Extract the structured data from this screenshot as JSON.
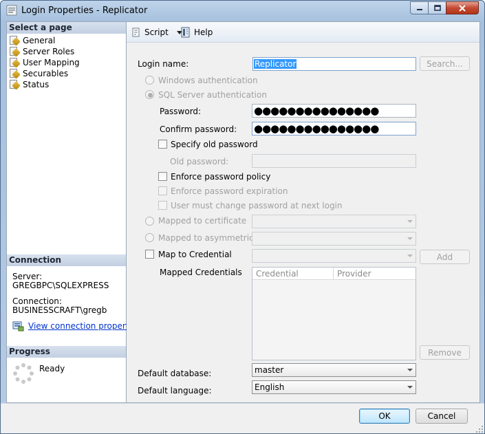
{
  "window": {
    "title": "Login Properties - Replicator"
  },
  "left": {
    "select_page_heading": "Select a page",
    "pages": [
      {
        "label": "General"
      },
      {
        "label": "Server Roles"
      },
      {
        "label": "User Mapping"
      },
      {
        "label": "Securables"
      },
      {
        "label": "Status"
      }
    ],
    "connection_heading": "Connection",
    "server_label": "Server:",
    "server_value": "GREGBPC\\SQLEXPRESS",
    "connection_label": "Connection:",
    "connection_value": "BUSINESSCRAFT\\gregb",
    "view_conn_link": "View connection properties",
    "progress_heading": "Progress",
    "progress_status": "Ready"
  },
  "toolbar": {
    "script_label": "Script",
    "help_label": "Help"
  },
  "form": {
    "login_name_label": "Login name:",
    "login_name_value": "Replicator",
    "search_button": "Search...",
    "windows_auth": "Windows authentication",
    "sql_auth": "SQL Server authentication",
    "password_label": "Password:",
    "password_value": "●●●●●●●●●●●●●●●",
    "confirm_label": "Confirm password:",
    "confirm_value": "●●●●●●●●●●●●●●●",
    "specify_old": "Specify old password",
    "old_password_label": "Old password:",
    "enforce_policy": "Enforce password policy",
    "enforce_expiration": "Enforce password expiration",
    "must_change": "User must change password at next login",
    "mapped_cert": "Mapped to certificate",
    "mapped_asym": "Mapped to asymmetric key",
    "map_credential": "Map to Credential",
    "add_button": "Add",
    "mapped_credentials_label": "Mapped Credentials",
    "cred_columns": [
      "Credential",
      "Provider"
    ],
    "remove_button": "Remove",
    "default_db_label": "Default database:",
    "default_db_value": "master",
    "default_lang_label": "Default language:",
    "default_lang_value": "English"
  },
  "buttons": {
    "ok": "OK",
    "cancel": "Cancel"
  }
}
